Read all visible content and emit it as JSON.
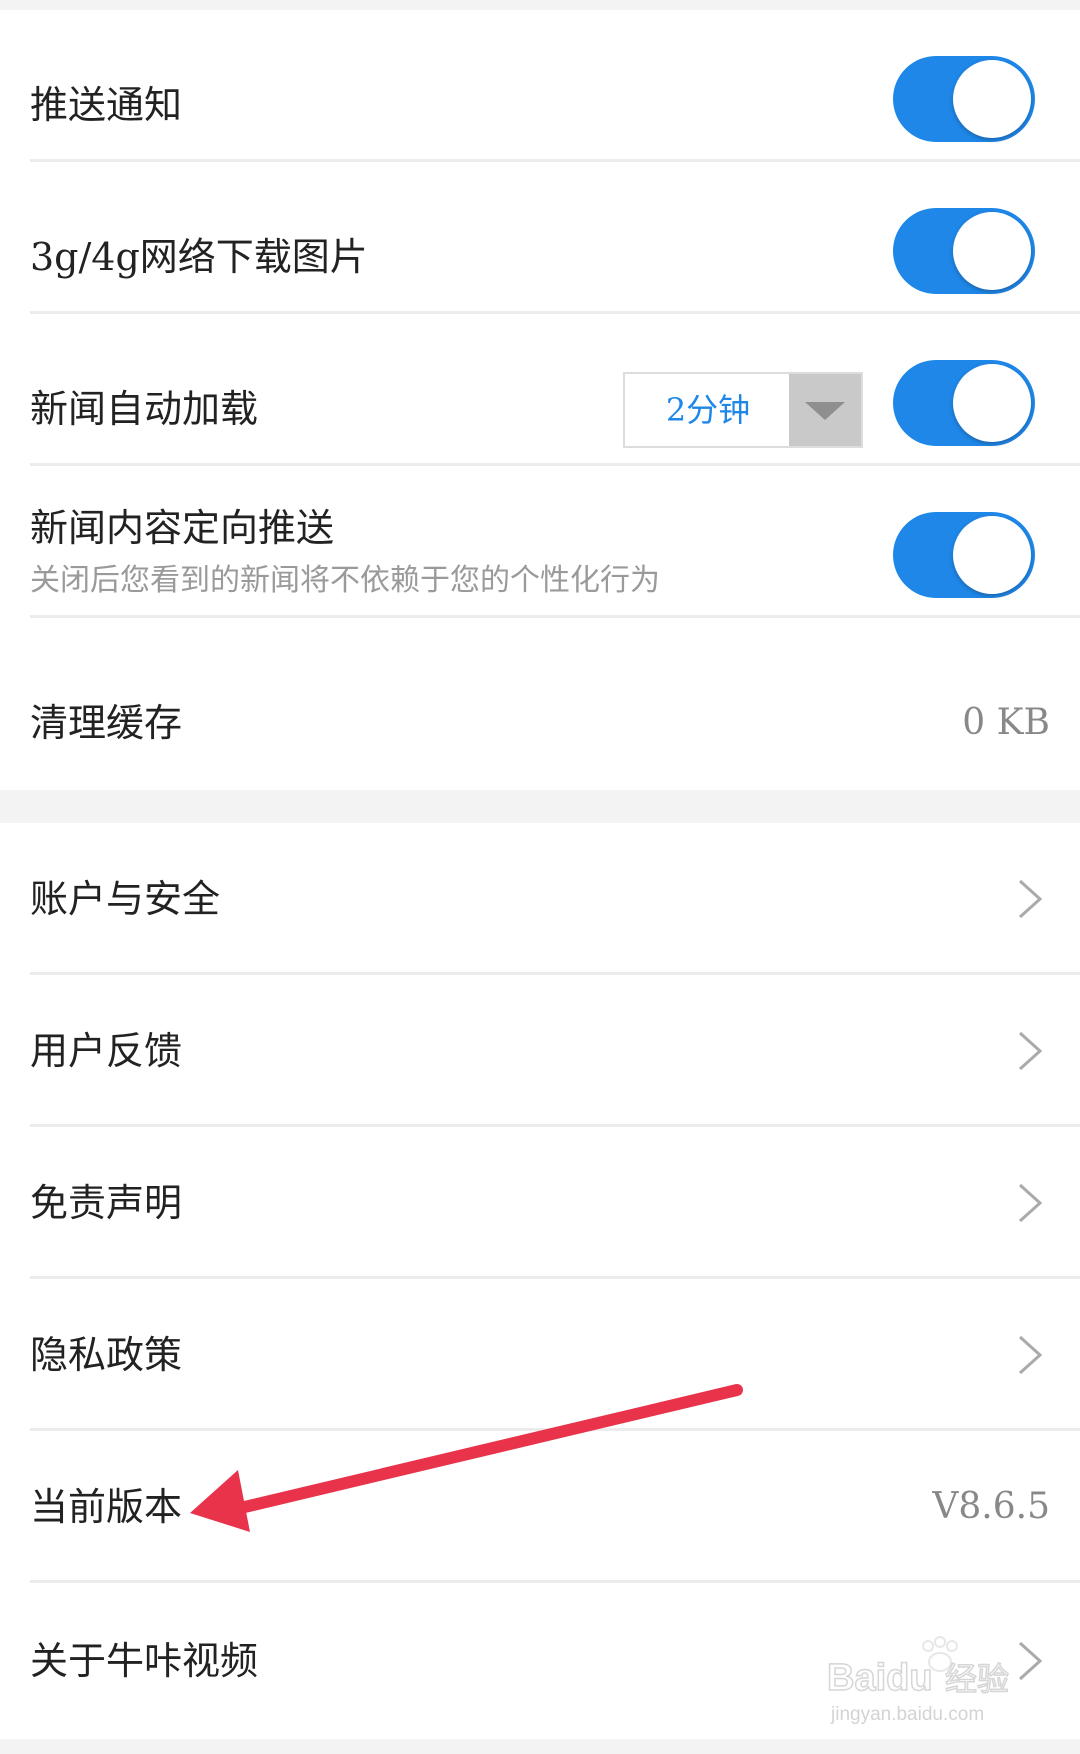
{
  "settings": {
    "push_notification": {
      "label": "推送通知",
      "enabled": true
    },
    "mobile_download_images": {
      "label": "3g/4g网络下载图片",
      "enabled": true
    },
    "news_auto_load": {
      "label": "新闻自动加载",
      "interval": "2分钟",
      "enabled": true
    },
    "targeted_push": {
      "label": "新闻内容定向推送",
      "description": "关闭后您看到的新闻将不依赖于您的个性化行为",
      "enabled": true
    },
    "clear_cache": {
      "label": "清理缓存",
      "value": "0 KB"
    }
  },
  "more": {
    "account_security": {
      "label": "账户与安全"
    },
    "user_feedback": {
      "label": "用户反馈"
    },
    "disclaimer": {
      "label": "免责声明"
    },
    "privacy_policy": {
      "label": "隐私政策"
    },
    "current_version": {
      "label": "当前版本",
      "value": "V8.6.5"
    },
    "about": {
      "label": "关于牛咔视频"
    }
  },
  "annotation": {
    "arrow_color": "#e8334a"
  },
  "watermark": {
    "brand": "Baidu",
    "brand_cn": "经验",
    "url": "jingyan.baidu.com"
  },
  "colors": {
    "accent": "#1f87e8",
    "background": "#f3f3f3"
  },
  "icons": {
    "row_arrow": "chevron-right-icon",
    "dropdown": "triangle-down-icon"
  }
}
